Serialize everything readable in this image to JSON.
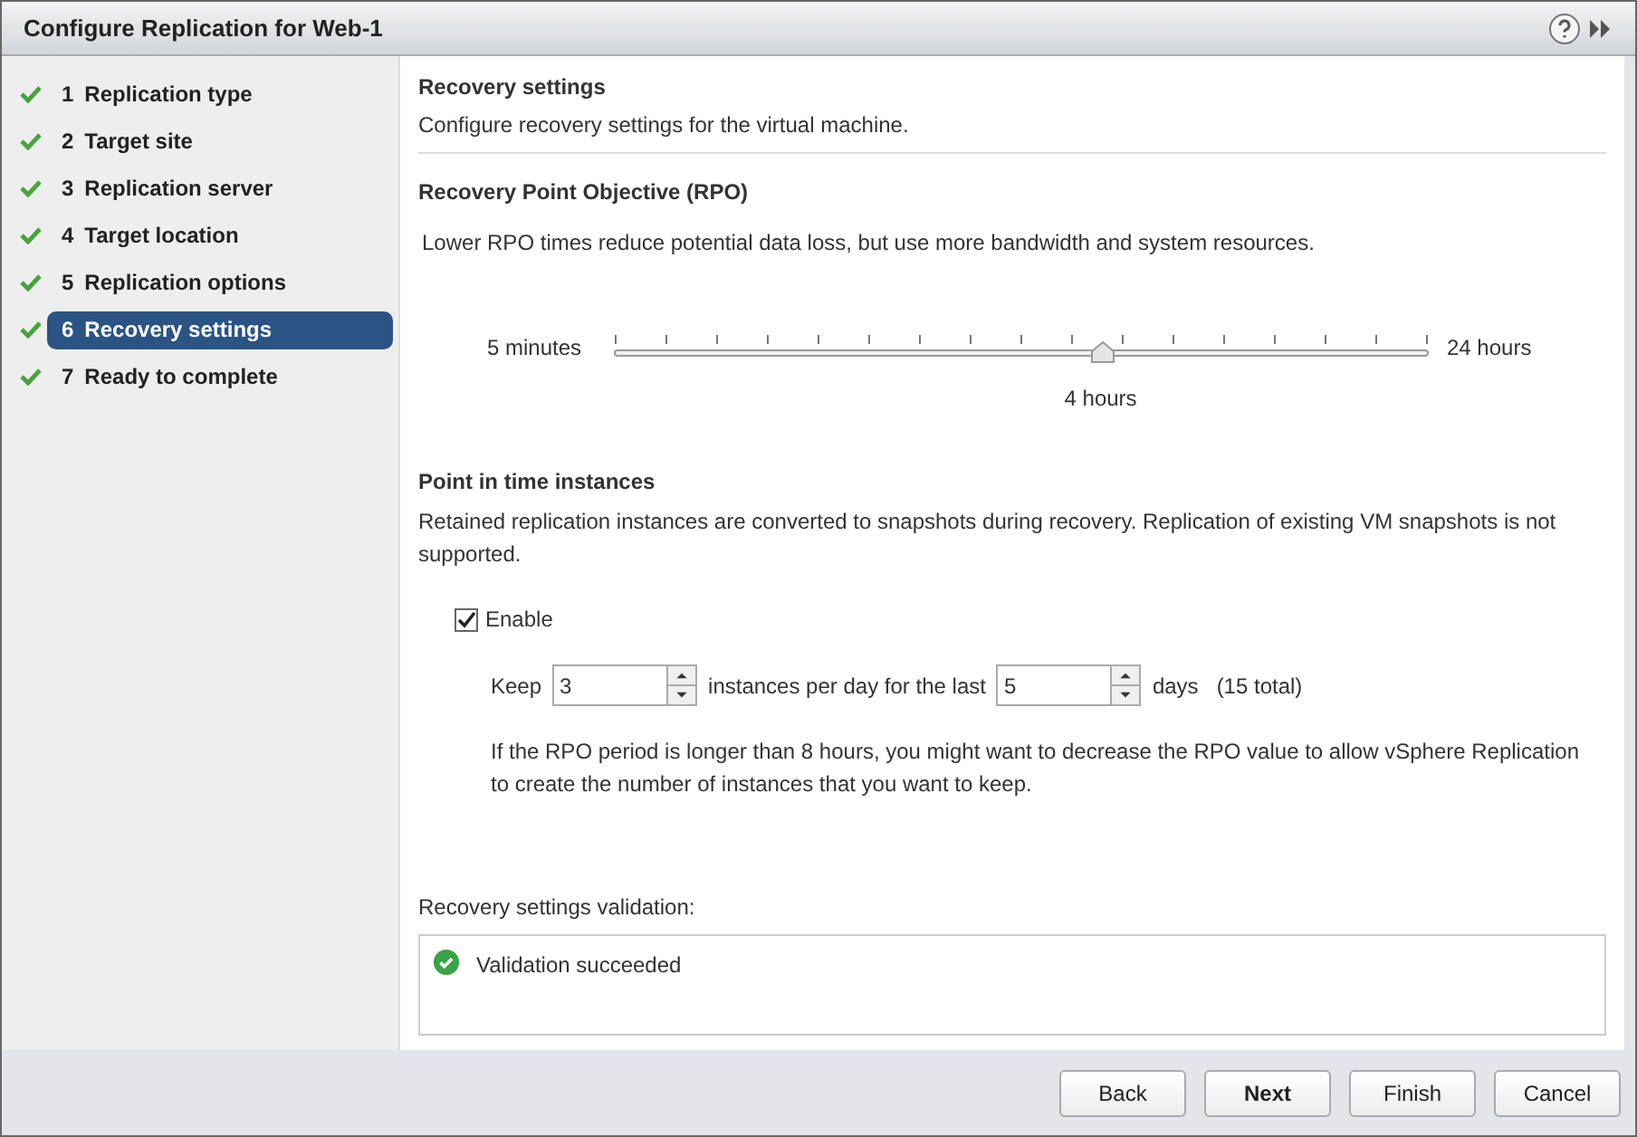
{
  "window": {
    "title": "Configure Replication for Web-1"
  },
  "steps": [
    {
      "number": "1",
      "label": "Replication type",
      "done": true,
      "selected": false
    },
    {
      "number": "2",
      "label": "Target site",
      "done": true,
      "selected": false
    },
    {
      "number": "3",
      "label": "Replication server",
      "done": true,
      "selected": false
    },
    {
      "number": "4",
      "label": "Target location",
      "done": true,
      "selected": false
    },
    {
      "number": "5",
      "label": "Replication options",
      "done": true,
      "selected": false
    },
    {
      "number": "6",
      "label": "Recovery settings",
      "done": true,
      "selected": true
    },
    {
      "number": "7",
      "label": "Ready to complete",
      "done": true,
      "selected": false
    }
  ],
  "header": {
    "title": "Recovery settings",
    "subtitle": "Configure recovery settings for the virtual machine."
  },
  "rpo": {
    "title": "Recovery Point Objective (RPO)",
    "description": "Lower RPO times reduce potential data loss, but use more bandwidth and system resources.",
    "min_label": "5 minutes",
    "max_label": "24 hours",
    "level": 0.6,
    "value_label": "4 hours"
  },
  "pit": {
    "title": "Point in time instances",
    "description": "Retained replication instances are converted to snapshots during recovery. Replication of existing VM snapshots is not supported.",
    "enable": {
      "label": "Enable",
      "checked": true
    },
    "keep_label": "Keep",
    "instances_value": "3",
    "instances_label": "instances per day for the last",
    "days_value": "5",
    "days_label": "days",
    "total": "(15 total)",
    "note": "If the RPO period is longer than 8 hours, you might want to decrease the RPO value to allow vSphere Replication to create the number of instances that you want to keep."
  },
  "validation": {
    "label": "Recovery settings validation:",
    "message": "Validation succeeded"
  },
  "buttons": [
    {
      "label": "Back",
      "default": false
    },
    {
      "label": "Next",
      "default": true
    },
    {
      "label": "Finish",
      "default": false
    },
    {
      "label": "Cancel",
      "default": false
    }
  ]
}
